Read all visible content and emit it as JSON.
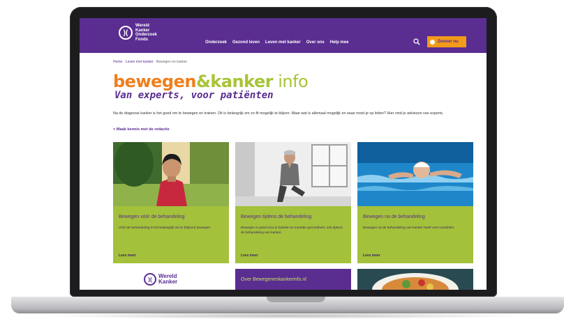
{
  "header": {
    "logo_lines": [
      "Wereld",
      "Kanker",
      "Onderzoek",
      "Fonds"
    ],
    "nav": [
      "Onderzoek",
      "Gezond leven",
      "Leven met kanker",
      "Over ons",
      "Help mee"
    ],
    "donate_label": "Doneer nu"
  },
  "breadcrumb": {
    "items": [
      "Home",
      "Leven met kanker",
      "Bewegen en kanker"
    ]
  },
  "brand": {
    "part1": "bewegen",
    "part2": "&kanker",
    "part3": " info",
    "subtitle": "Van experts, voor patiënten"
  },
  "intro": {
    "text": "Na de diagnose kanker is het goed om te bewegen en trainen. Dit is belangrijk om zo fit mogelijk te blijven. Maar wat is allemaal mogelijk en waar moet je op letten? Hier vind je adviezen van experts.",
    "link": "> Maak kennis met de redactie"
  },
  "cards": [
    {
      "title": "Bewegen vóór de behandeling",
      "desc": "Vóór de behandeling is het belangrijk om te (blijven) bewegen.",
      "more": "Lees meer"
    },
    {
      "title": "Bewegen tijdens de behandeling",
      "desc": "Bewegen is goed voor je fysieke en mentale gezondheid, ook tijdens de behandeling van kanker.",
      "more": "Lees meer"
    },
    {
      "title": "Bewegen na de behandeling",
      "desc": "Bewegen na de behandeling van kanker heeft veel voordelen.",
      "more": "Lees meer"
    }
  ],
  "bottom": {
    "logo_lines": [
      "Wereld",
      "Kanker"
    ],
    "about": "Over Bewegenenkankerinfo.nl"
  },
  "colors": {
    "purple": "#5a2d91",
    "orange": "#f29a1a",
    "green": "#a3c13a"
  }
}
